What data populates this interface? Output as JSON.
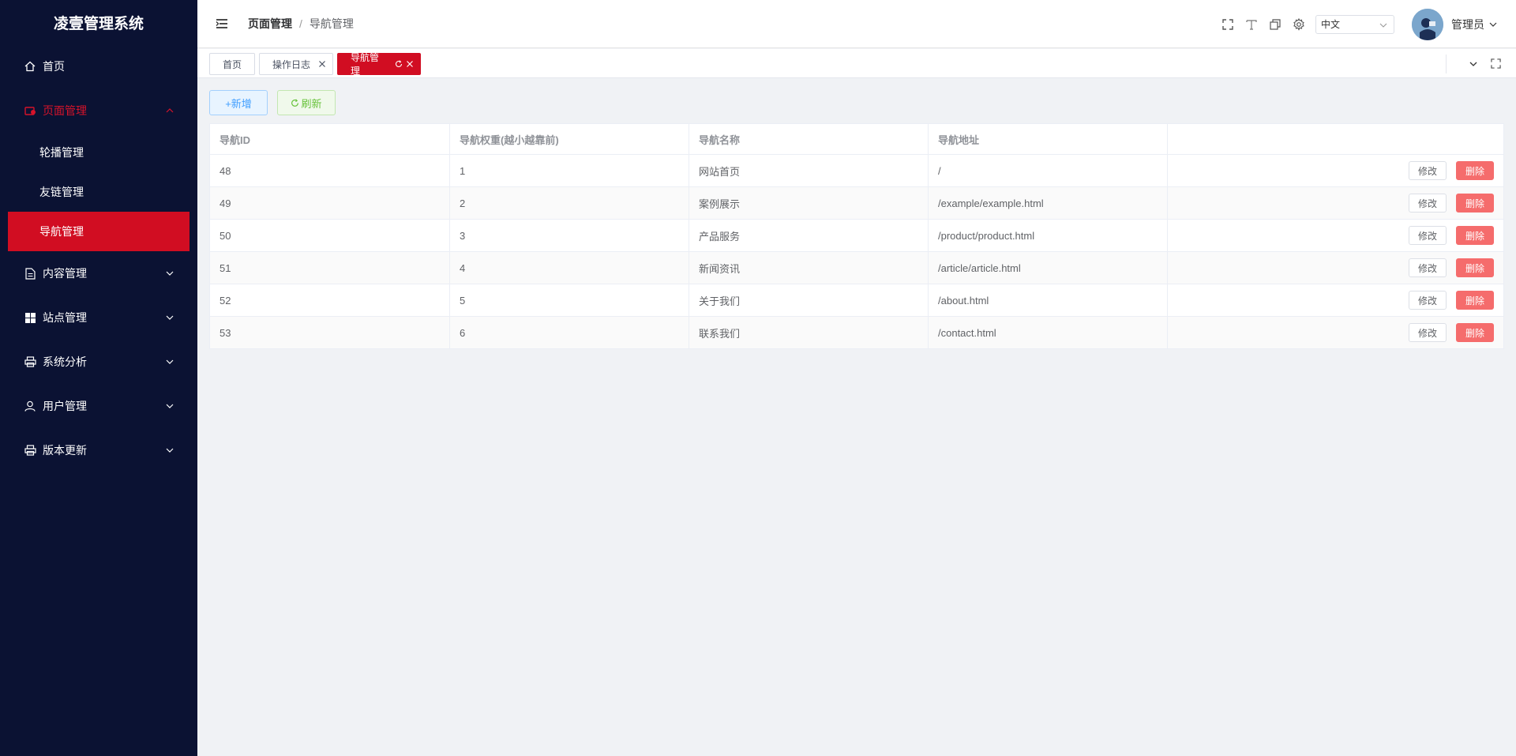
{
  "app": {
    "title": "凌壹管理系统"
  },
  "sidebar": {
    "items": [
      {
        "label": "首页",
        "icon": "home-icon"
      },
      {
        "label": "页面管理",
        "icon": "page-icon",
        "expanded": true,
        "children": [
          {
            "label": "轮播管理"
          },
          {
            "label": "友链管理"
          },
          {
            "label": "导航管理",
            "active": true
          }
        ]
      },
      {
        "label": "内容管理",
        "icon": "document-icon"
      },
      {
        "label": "站点管理",
        "icon": "grid-icon"
      },
      {
        "label": "系统分析",
        "icon": "printer-icon"
      },
      {
        "label": "用户管理",
        "icon": "user-icon"
      },
      {
        "label": "版本更新",
        "icon": "printer-icon"
      }
    ]
  },
  "header": {
    "breadcrumb": [
      "页面管理",
      "导航管理"
    ],
    "breadcrumb_separator": "/",
    "language": "中文",
    "username": "管理员"
  },
  "tabs": [
    {
      "label": "首页",
      "closable": false
    },
    {
      "label": "操作日志",
      "closable": true
    },
    {
      "label": "导航管理",
      "closable": true,
      "active": true
    }
  ],
  "toolbar": {
    "add_label": "+新增",
    "refresh_label": "刷新"
  },
  "table": {
    "columns": [
      "导航ID",
      "导航权重(越小越靠前)",
      "导航名称",
      "导航地址",
      ""
    ],
    "rows": [
      [
        "48",
        "1",
        "网站首页",
        "/"
      ],
      [
        "49",
        "2",
        "案例展示",
        "/example/example.html"
      ],
      [
        "50",
        "3",
        "产品服务",
        "/product/product.html"
      ],
      [
        "51",
        "4",
        "新闻资讯",
        "/article/article.html"
      ],
      [
        "52",
        "5",
        "关于我们",
        "/about.html"
      ],
      [
        "53",
        "6",
        "联系我们",
        "/contact.html"
      ]
    ],
    "edit_label": "修改",
    "delete_label": "删除"
  },
  "colors": {
    "sidebar_bg": "#0b1233",
    "accent": "#d10d22",
    "delete": "#f56c6c",
    "add": "#409eff",
    "refresh": "#67c23a"
  }
}
